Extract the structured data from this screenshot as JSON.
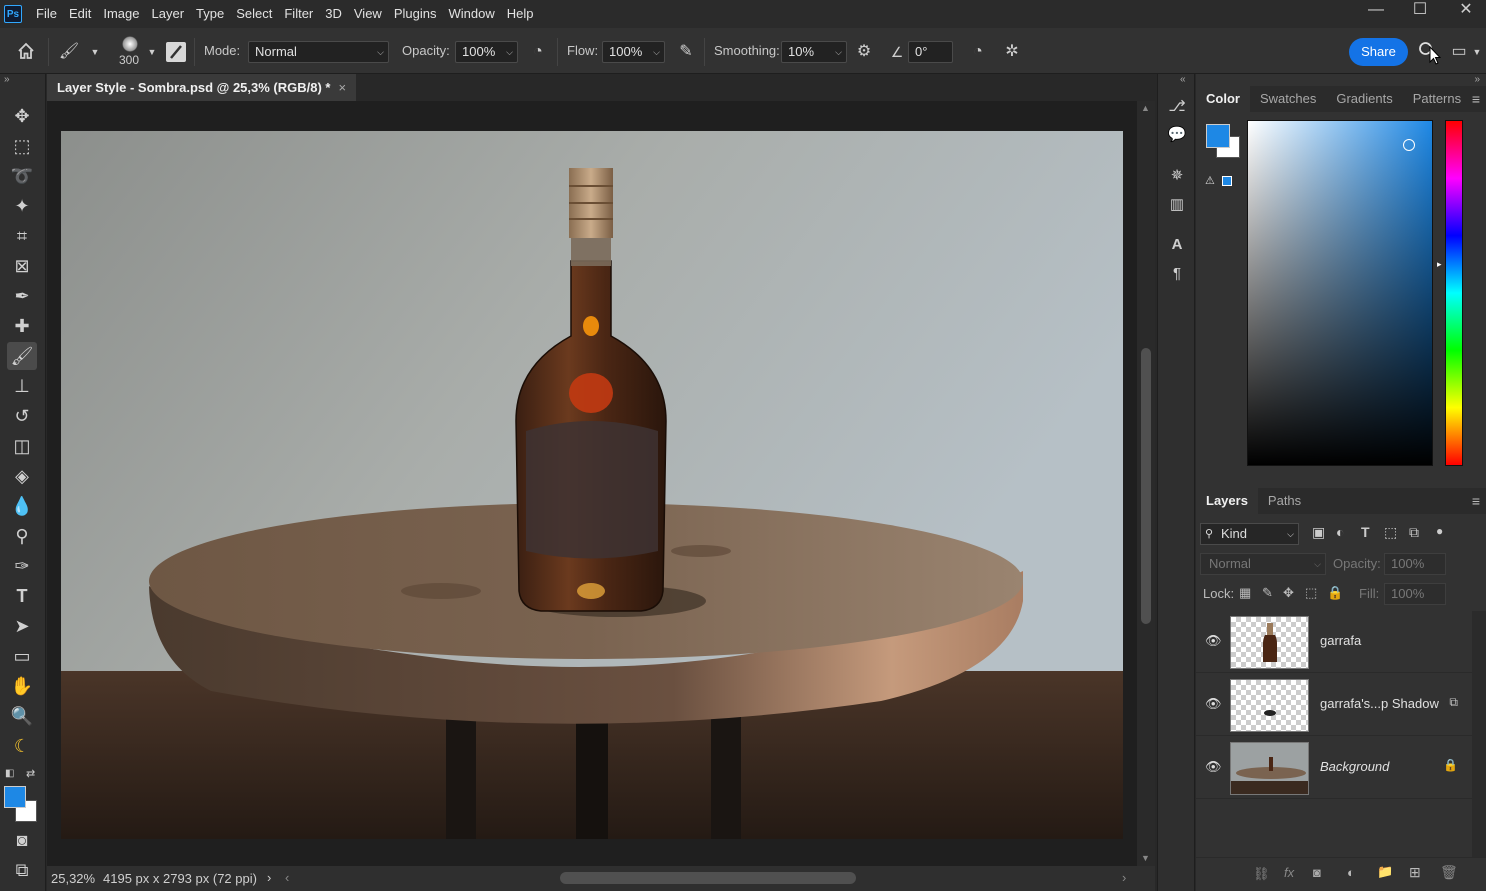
{
  "app": {
    "logo": "Ps"
  },
  "menu": [
    "File",
    "Edit",
    "Image",
    "Layer",
    "Type",
    "Select",
    "Filter",
    "3D",
    "View",
    "Plugins",
    "Window",
    "Help"
  ],
  "window_controls": {
    "minimize": "—",
    "maximize": "☐",
    "close": "✕"
  },
  "options_bar": {
    "brush_size": "300",
    "mode_label": "Mode:",
    "mode_value": "Normal",
    "opacity_label": "Opacity:",
    "opacity_value": "100%",
    "flow_label": "Flow:",
    "flow_value": "100%",
    "smoothing_label": "Smoothing:",
    "smoothing_value": "10%",
    "angle_value": "0°",
    "share_label": "Share"
  },
  "document": {
    "tab_title": "Layer Style - Sombra.psd @ 25,3% (RGB/8) *",
    "tab_close": "×",
    "zoom": "25,32%",
    "dimensions": "4195 px x 2793 px (72 ppi)",
    "status_arrow_right": "›",
    "status_arrow_left": "‹"
  },
  "color_panel": {
    "tabs": [
      "Color",
      "Swatches",
      "Gradients",
      "Patterns"
    ],
    "foreground": "#1e88e5",
    "background": "#ffffff"
  },
  "layers_panel": {
    "tabs": [
      "Layers",
      "Paths"
    ],
    "filter_kind": "Kind",
    "blend_mode": "Normal",
    "opacity_label": "Opacity:",
    "opacity_value": "100%",
    "lock_label": "Lock:",
    "fill_label": "Fill:",
    "fill_value": "100%",
    "layers": [
      {
        "name": "garrafa"
      },
      {
        "name": "garrafa's...p Shadow"
      },
      {
        "name": "Background"
      }
    ]
  },
  "colors": {
    "accent": "#1473e6",
    "panel_bg": "#323232",
    "canvas_bg": "#1f1f1f"
  }
}
